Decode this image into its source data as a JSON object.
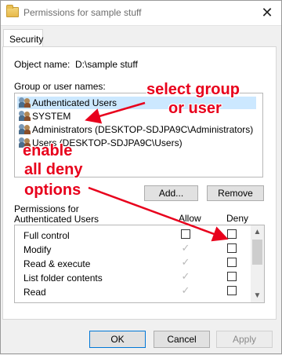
{
  "window": {
    "title": "Permissions for sample stuff",
    "close_glyph": "✕"
  },
  "tab": {
    "label": "Security"
  },
  "object": {
    "label": "Object name:",
    "value": "D:\\sample stuff"
  },
  "groups": {
    "label": "Group or user names:",
    "users": [
      {
        "name": "Authenticated Users",
        "icon": "users-icon",
        "selected": true
      },
      {
        "name": "SYSTEM",
        "icon": "users-icon"
      },
      {
        "name": "Administrators (DESKTOP-SDJPA9C\\Administrators)",
        "icon": "users-icon"
      },
      {
        "name": "Users (DESKTOP-SDJPA9C\\Users)",
        "icon": "users-icon"
      }
    ]
  },
  "buttons": {
    "add": "Add...",
    "remove": "Remove",
    "ok": "OK",
    "cancel": "Cancel",
    "apply": "Apply"
  },
  "permissions": {
    "for_label": "Permissions for Authenticated Users",
    "allow_header": "Allow",
    "deny_header": "Deny",
    "rows": [
      {
        "name": "Full control",
        "allow": false,
        "deny": false
      },
      {
        "name": "Modify",
        "allow": true,
        "deny": false
      },
      {
        "name": "Read & execute",
        "allow": true,
        "deny": false
      },
      {
        "name": "List folder contents",
        "allow": true,
        "deny": false
      },
      {
        "name": "Read",
        "allow": true,
        "deny": false
      }
    ]
  },
  "annotations": {
    "select_line1": "select group",
    "select_line2": "or user",
    "enable_line1": "enable",
    "enable_line2": "all deny",
    "enable_line3": "options",
    "color": "#e8001c"
  },
  "colors": {
    "selection": "#cce8ff",
    "button_bg": "#e1e1e1",
    "default_button_border": "#0078d7"
  }
}
